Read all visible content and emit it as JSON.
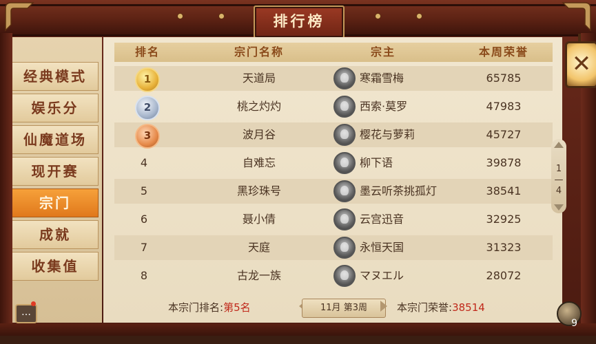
{
  "title": "排行榜",
  "sidebar": {
    "items": [
      {
        "label": "经典模式"
      },
      {
        "label": "娱乐分"
      },
      {
        "label": "仙魔道场"
      },
      {
        "label": "现开赛"
      },
      {
        "label": "宗门",
        "active": true
      },
      {
        "label": "成就"
      },
      {
        "label": "收集值"
      }
    ]
  },
  "table": {
    "headers": [
      "排名",
      "宗门名称",
      "宗主",
      "本周荣誉"
    ],
    "rows": [
      {
        "rank": "1",
        "medal": "gold",
        "sect": "天道局",
        "leader": "寒霜雪梅",
        "honor": "65785"
      },
      {
        "rank": "2",
        "medal": "silver",
        "sect": "桃之灼灼",
        "leader": "西索·莫罗",
        "honor": "47983"
      },
      {
        "rank": "3",
        "medal": "bronze",
        "sect": "波月谷",
        "leader": "樱花与萝莉",
        "honor": "45727"
      },
      {
        "rank": "4",
        "sect": "自难忘",
        "leader": "柳下语",
        "honor": "39878"
      },
      {
        "rank": "5",
        "sect": "黑珍珠号",
        "leader": "墨云听茶挑孤灯",
        "honor": "38541"
      },
      {
        "rank": "6",
        "sect": "聂小倩",
        "leader": "云宫迅音",
        "honor": "32925"
      },
      {
        "rank": "7",
        "sect": "天庭",
        "leader": "永恒天国",
        "honor": "31323"
      },
      {
        "rank": "8",
        "sect": "古龙一族",
        "leader": "マヌエル",
        "honor": "28072"
      }
    ]
  },
  "footer": {
    "my_rank_label": "本宗门排名:",
    "my_rank_value": "第5名",
    "week": "11月 第3周",
    "my_honor_label": "本宗门荣誉:",
    "my_honor_value": "38514"
  },
  "pager": {
    "current": "1",
    "total": "4"
  },
  "badge_count": "9",
  "colors": {
    "accent": "#e0781c",
    "highlight": "#c0281a",
    "frame": "#6b2a1b"
  }
}
